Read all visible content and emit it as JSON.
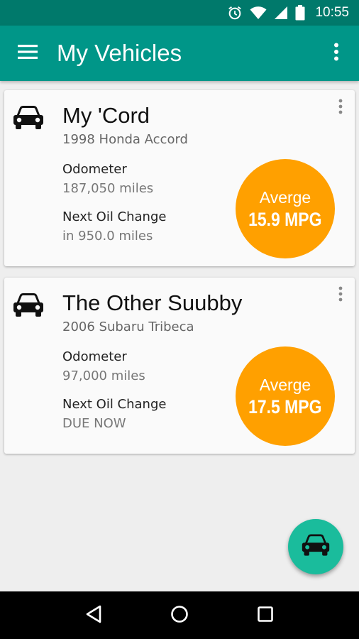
{
  "status_bar": {
    "time": "10:55",
    "icons": [
      "alarm-icon",
      "wifi-icon",
      "signal-icon",
      "battery-icon"
    ]
  },
  "app_bar": {
    "title": "My Vehicles",
    "menu_icon": "hamburger-menu-icon",
    "overflow_icon": "more-vert-icon"
  },
  "vehicles": [
    {
      "name": "My 'Cord",
      "model": "1998 Honda Accord",
      "odometer_label": "Odometer",
      "odometer_value": "187,050 miles",
      "oil_label": "Next Oil Change",
      "oil_value": "in 950.0 miles",
      "avg_label": "Averge",
      "avg_value": "15.9 MPG"
    },
    {
      "name": "The Other Suubby",
      "model": "2006 Subaru Tribeca",
      "odometer_label": "Odometer",
      "odometer_value": "97,000 miles",
      "oil_label": "Next Oil Change",
      "oil_value": "DUE NOW",
      "avg_label": "Averge",
      "avg_value": "17.5 MPG"
    }
  ],
  "fab": {
    "icon": "car-icon"
  },
  "nav_bar": {
    "icons": [
      "back-icon",
      "home-icon",
      "recents-icon"
    ]
  },
  "colors": {
    "status_bar": "#00796b",
    "app_bar": "#009688",
    "mpg_circle": "#ffa000",
    "fab": "#1abc9c"
  }
}
